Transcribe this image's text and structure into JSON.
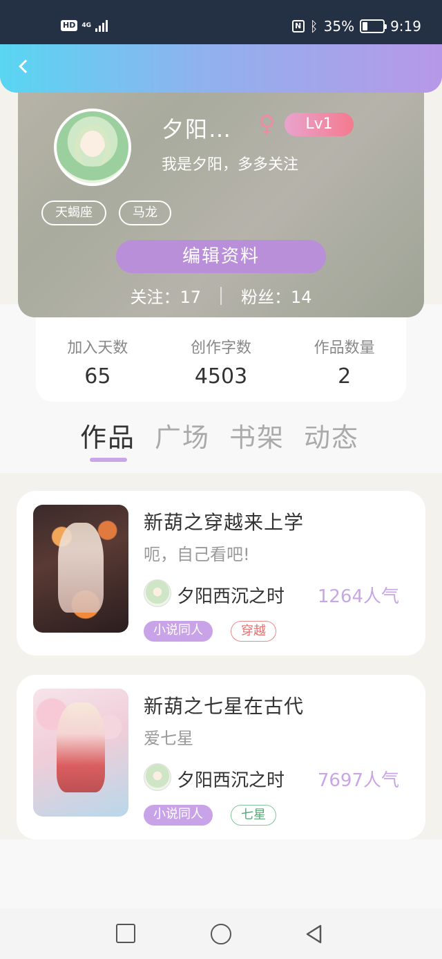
{
  "status_bar": {
    "hd": "HD",
    "network": "4G",
    "battery_percent": "35%",
    "battery_level": 0.35,
    "time": "9:19"
  },
  "profile": {
    "nickname": "夕阳…",
    "gender_symbol": "♀",
    "level": "Lv1",
    "bio": "我是夕阳，多多关注",
    "tags": [
      "天蝎座",
      "马龙"
    ],
    "edit_label": "编辑资料",
    "following_label": "关注：",
    "following_count": "17",
    "fans_label": "粉丝：",
    "fans_count": "14"
  },
  "stats": [
    {
      "label": "加入天数",
      "value": "65"
    },
    {
      "label": "创作字数",
      "value": "4503"
    },
    {
      "label": "作品数量",
      "value": "2"
    }
  ],
  "tabs": [
    {
      "label": "作品",
      "active": true
    },
    {
      "label": "广场",
      "active": false
    },
    {
      "label": "书架",
      "active": false
    },
    {
      "label": "动态",
      "active": false
    }
  ],
  "works": [
    {
      "title": "新葫之穿越来上学",
      "description": "呃，自己看吧!",
      "author": "夕阳西沉之时",
      "popularity": "1264人气",
      "category": "小说同人",
      "tag": "穿越"
    },
    {
      "title": "新葫之七星在古代",
      "description": "爱七星",
      "author": "夕阳西沉之时",
      "popularity": "7697人气",
      "category": "小说同人",
      "tag": "七星"
    }
  ],
  "colors": {
    "accent_purple": "#b98fd9",
    "header_gradient_start": "#58d6f2",
    "header_gradient_end": "#b798e8",
    "popularity": "#c8a6e6"
  }
}
